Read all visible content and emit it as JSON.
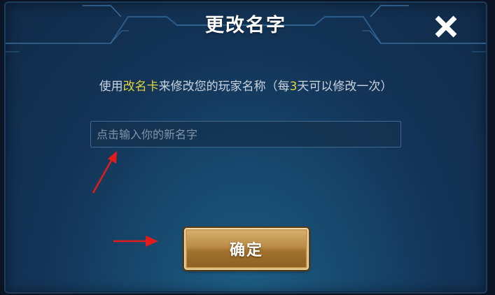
{
  "dialog": {
    "title": "更改名字",
    "description": {
      "part1": "使用",
      "item_name": "改名卡",
      "part2": "来修改您的玩家名称（每",
      "days": "3",
      "part3": "天可以修改一次）"
    },
    "name_input": {
      "value": "",
      "placeholder": "点击输入你的新名字"
    },
    "confirm_label": "确定",
    "close_icon": "close-x-icon"
  },
  "colors": {
    "highlight": "#e2d33a",
    "annotation_arrow": "#e21b1b",
    "button_gold": "#b98b46"
  }
}
